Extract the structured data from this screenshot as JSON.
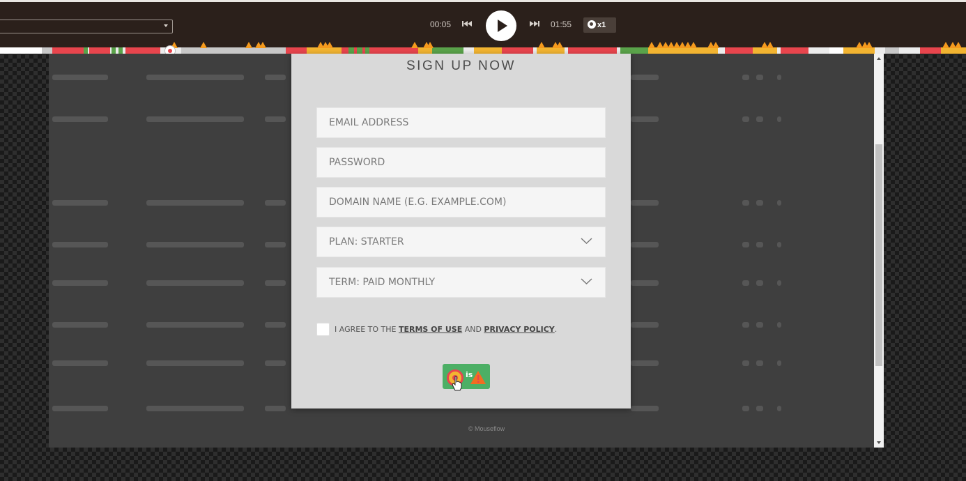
{
  "player": {
    "current_time": "00:05",
    "total_time": "01:55",
    "speed": "x1",
    "page_select_value": ""
  },
  "modal": {
    "title": "SIGN UP NOW",
    "email_placeholder": "EMAIL ADDRESS",
    "password_placeholder": "PASSWORD",
    "domain_placeholder": "DOMAIN NAME (E.G. EXAMPLE.COM)",
    "plan_value": "PLAN: STARTER",
    "term_value": "TERM: PAID MONTHLY",
    "agree_prefix": "I AGREE TO THE ",
    "terms_link": "TERMS OF USE",
    "agree_middle": " AND ",
    "privacy_link": "PRIVACY POLICY",
    "agree_suffix": ".",
    "submit_fragment": "is"
  },
  "footer": {
    "copyright": "© Mouseflow"
  },
  "colors": {
    "player_bg": "#2b201b",
    "accent_red": "#e8454d",
    "accent_green": "#4caf65",
    "warning_orange": "#f59a1d",
    "modal_bg": "#d9d9d9"
  },
  "icons": [
    "skip-back-icon",
    "play-icon",
    "skip-forward-icon",
    "globe-icon",
    "chevron-down-icon",
    "warning-icon",
    "click-marker-icon",
    "hand-cursor-icon"
  ]
}
